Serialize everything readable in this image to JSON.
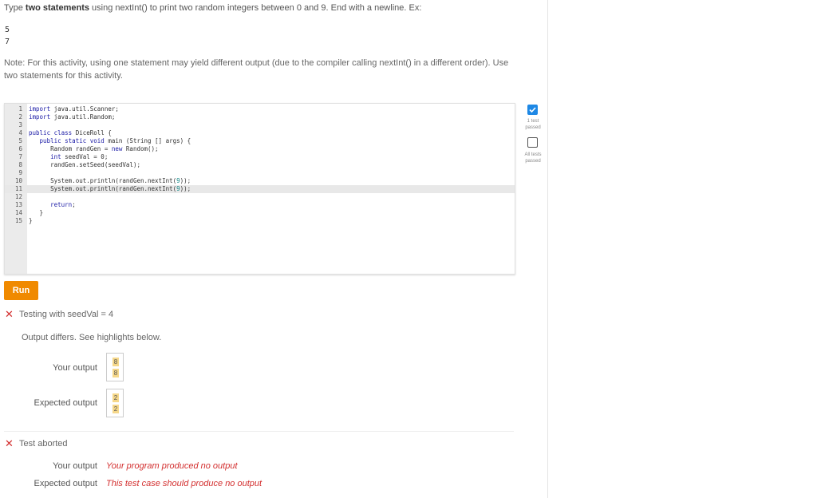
{
  "instructions": {
    "prefix": "Type ",
    "bold": "two statements",
    "rest": " using nextInt() to print two random integers between 0 and 9. End with a newline. Ex:"
  },
  "example_lines": [
    "5",
    "7"
  ],
  "note": "Note: For this activity, using one statement may yield different output (due to the compiler calling nextInt() in a different order). Use two statements for this activity.",
  "editor": {
    "lines": [
      {
        "n": "1",
        "code": "import java.util.Scanner;"
      },
      {
        "n": "2",
        "code": "import java.util.Random;"
      },
      {
        "n": "3",
        "code": ""
      },
      {
        "n": "4",
        "code": "public class DiceRoll {"
      },
      {
        "n": "5",
        "code": "   public static void main (String [] args) {"
      },
      {
        "n": "6",
        "code": "      Random randGen = new Random();"
      },
      {
        "n": "7",
        "code": "      int seedVal = 0;"
      },
      {
        "n": "8",
        "code": "      randGen.setSeed(seedVal);"
      },
      {
        "n": "9",
        "code": ""
      },
      {
        "n": "10",
        "code": "      System.out.println(randGen.nextInt(9));"
      },
      {
        "n": "11",
        "code": "      System.out.println(randGen.nextInt(9));"
      },
      {
        "n": "12",
        "code": ""
      },
      {
        "n": "13",
        "code": "      return;"
      },
      {
        "n": "14",
        "code": "   }"
      },
      {
        "n": "15",
        "code": "}"
      }
    ],
    "active_line": "11"
  },
  "run_label": "Run",
  "test1": {
    "title": "Testing with seedVal = 4",
    "message": "Output differs. See highlights below.",
    "your_output_label": "Your output",
    "your_output": [
      "8",
      "8"
    ],
    "expected_output_label": "Expected output",
    "expected_output": [
      "2",
      "2"
    ]
  },
  "test2": {
    "title": "Test aborted",
    "your_output_label": "Your output",
    "your_output_msg": "Your program produced no output",
    "expected_output_label": "Expected output",
    "expected_output_msg": "This test case should produce no output"
  },
  "sidebar": {
    "check1_label": "1 test passed",
    "check2_label": "All tests passed"
  },
  "colors": {
    "run_button": "#f08a00",
    "error": "#d32f2f",
    "check": "#1e88e5"
  }
}
